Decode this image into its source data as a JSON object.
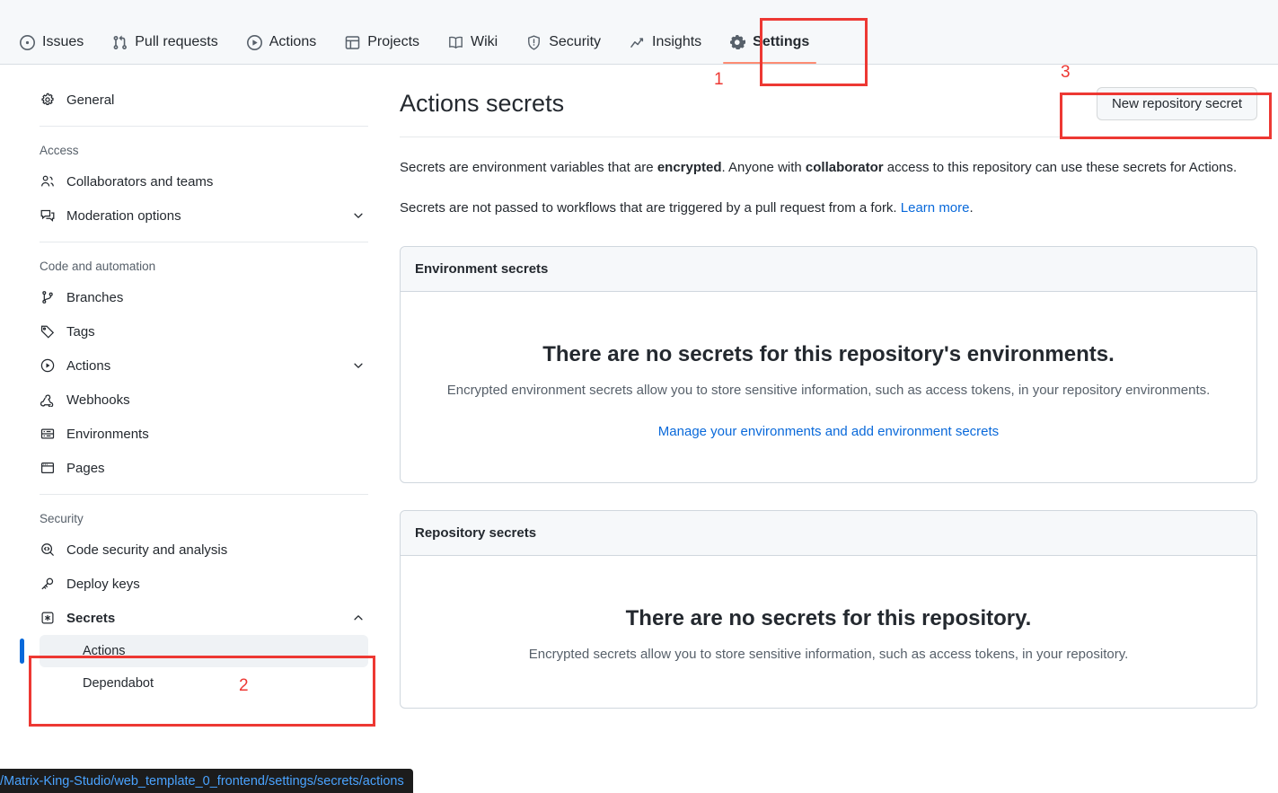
{
  "repo_nav": {
    "tabs": [
      {
        "label": "Issues",
        "icon": "issue-opened-icon",
        "selected": false
      },
      {
        "label": "Pull requests",
        "icon": "git-pull-request-icon",
        "selected": false
      },
      {
        "label": "Actions",
        "icon": "play-circle-icon",
        "selected": false
      },
      {
        "label": "Projects",
        "icon": "table-icon",
        "selected": false
      },
      {
        "label": "Wiki",
        "icon": "book-icon",
        "selected": false
      },
      {
        "label": "Security",
        "icon": "shield-icon",
        "selected": false
      },
      {
        "label": "Insights",
        "icon": "graph-icon",
        "selected": false
      },
      {
        "label": "Settings",
        "icon": "gear-icon",
        "selected": true
      }
    ]
  },
  "sidebar": {
    "general": {
      "label": "General",
      "icon": "gear-icon"
    },
    "sections": [
      {
        "heading": "Access",
        "items": [
          {
            "label": "Collaborators and teams",
            "icon": "people-icon",
            "chevron": false
          },
          {
            "label": "Moderation options",
            "icon": "comment-discussion-icon",
            "chevron": true
          }
        ]
      },
      {
        "heading": "Code and automation",
        "items": [
          {
            "label": "Branches",
            "icon": "git-branch-icon",
            "chevron": false
          },
          {
            "label": "Tags",
            "icon": "tag-icon",
            "chevron": false
          },
          {
            "label": "Actions",
            "icon": "play-circle-icon",
            "chevron": true
          },
          {
            "label": "Webhooks",
            "icon": "webhook-icon",
            "chevron": false
          },
          {
            "label": "Environments",
            "icon": "server-icon",
            "chevron": false
          },
          {
            "label": "Pages",
            "icon": "browser-icon",
            "chevron": false
          }
        ]
      },
      {
        "heading": "Security",
        "items": [
          {
            "label": "Code security and analysis",
            "icon": "codescan-icon",
            "chevron": false
          },
          {
            "label": "Deploy keys",
            "icon": "key-icon",
            "chevron": false
          }
        ]
      }
    ],
    "secrets": {
      "label": "Secrets",
      "icon": "asterisk-key-icon",
      "chevron": "chevron-up-icon",
      "sub_items": [
        {
          "label": "Actions",
          "active": true
        },
        {
          "label": "Dependabot",
          "active": false
        }
      ]
    }
  },
  "main": {
    "title": "Actions secrets",
    "new_secret_button": "New repository secret",
    "paragraph1": {
      "part1": "Secrets are environment variables that are ",
      "bold1": "encrypted",
      "part2": ". Anyone with ",
      "bold2": "collaborator",
      "part3": " access to this repository can use these secrets for Actions."
    },
    "paragraph2": {
      "text": "Secrets are not passed to workflows that are triggered by a pull request from a fork. ",
      "link": "Learn more",
      "suffix": "."
    },
    "environment_card": {
      "header": "Environment secrets",
      "blank_title": "There are no secrets for this repository's environments.",
      "blank_desc": "Encrypted environment secrets allow you to store sensitive information, such as access tokens, in your repository environments.",
      "blank_link": "Manage your environments and add environment secrets"
    },
    "repository_card": {
      "header": "Repository secrets",
      "blank_title": "There are no secrets for this repository.",
      "blank_desc": "Encrypted secrets allow you to store sensitive information, such as access tokens, in your repository."
    }
  },
  "annotations": {
    "marker1": "1",
    "marker2": "2",
    "marker3": "3",
    "color": "#ed3833"
  },
  "statusbar": {
    "url": "/Matrix-King-Studio/web_template_0_frontend/settings/secrets/actions"
  }
}
